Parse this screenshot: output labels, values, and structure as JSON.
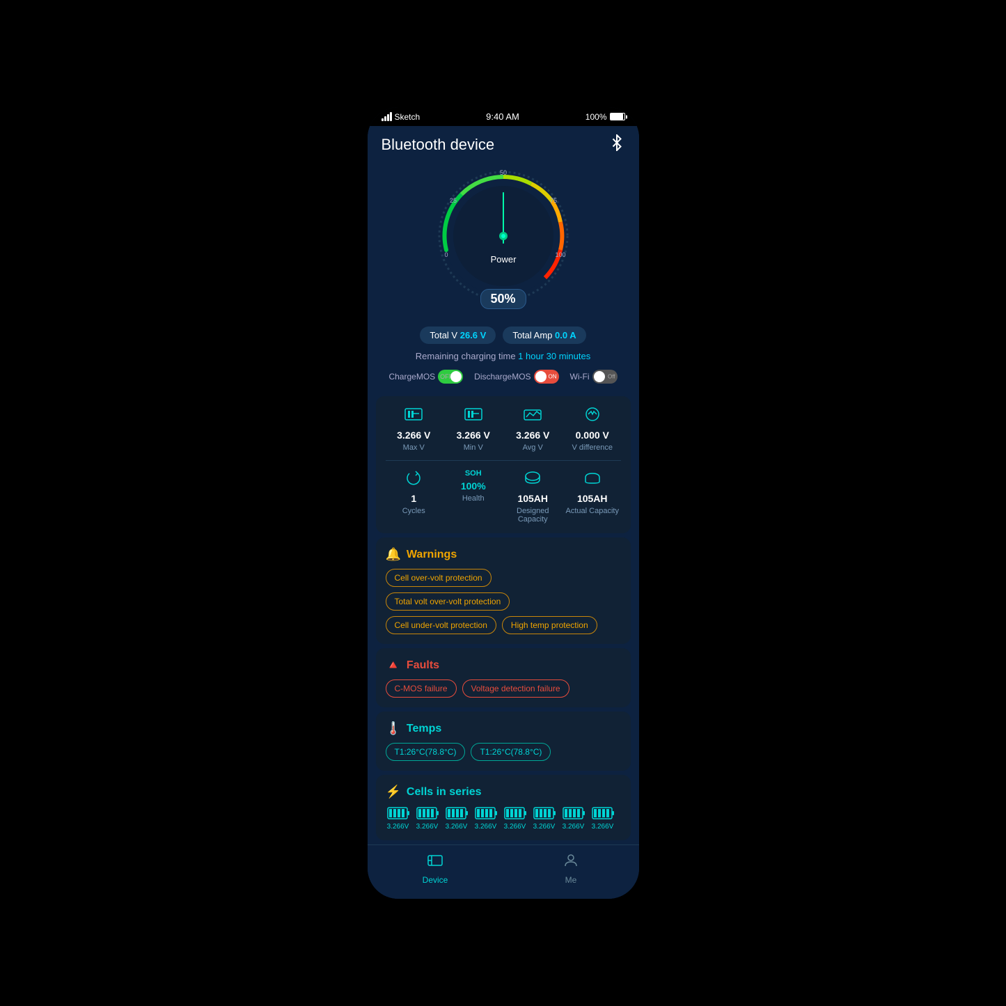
{
  "statusBar": {
    "signal": "●●●●",
    "carrier": "Sketch",
    "time": "9:40 AM",
    "battery": "100%"
  },
  "header": {
    "title": "Bluetooth device"
  },
  "gauge": {
    "powerLabel": "Power",
    "percent": "50%",
    "needleAngle": 0
  },
  "stats": {
    "totalVLabel": "Total V",
    "totalVValue": "26.6 V",
    "totalAmpLabel": "Total Amp",
    "totalAmpValue": "0.0 A",
    "remainingLabel": "Remaining charging time",
    "remainingValue": "1 hour 30 minutes"
  },
  "toggles": {
    "chargeMOS": {
      "label": "ChargeMOS",
      "state": "OFF",
      "on": true
    },
    "dischargeMOS": {
      "label": "DischargeMOS",
      "state": "ON",
      "on": true
    },
    "wifi": {
      "label": "Wi-Fi",
      "state": "Off",
      "on": false
    }
  },
  "cells": {
    "maxV": {
      "value": "3.266 V",
      "label": "Max V"
    },
    "minV": {
      "value": "3.266 V",
      "label": "Min V"
    },
    "avgV": {
      "value": "3.266 V",
      "label": "Avg V"
    },
    "vDiff": {
      "value": "0.000 V",
      "label": "V difference"
    },
    "cycles": {
      "value": "1",
      "label": "Cycles"
    },
    "soh": {
      "valuePercent": "100%",
      "label": "Health",
      "topLabel": "SOH"
    },
    "designedCap": {
      "value": "105AH",
      "label": "Designed Capacity"
    },
    "actualCap": {
      "value": "105AH",
      "label": "Actual Capacity"
    }
  },
  "warnings": {
    "sectionLabel": "Warnings",
    "items": [
      "Cell over-volt protection",
      "Total volt over-volt protection",
      "Cell under-volt protection",
      "High temp protection"
    ]
  },
  "faults": {
    "sectionLabel": "Faults",
    "items": [
      "C-MOS failure",
      "Voltage detection failure"
    ]
  },
  "temps": {
    "sectionLabel": "Temps",
    "items": [
      "T1:26°C(78.8°C)",
      "T1:26°C(78.8°C)"
    ]
  },
  "cellsSeries": {
    "sectionLabel": "Cells in series",
    "items": [
      "3.266V",
      "3.266V",
      "3.266V",
      "3.266V",
      "3.266V",
      "3.266V",
      "3.266V",
      "3.266V"
    ]
  },
  "bottomNav": {
    "deviceLabel": "Device",
    "meLabel": "Me"
  }
}
